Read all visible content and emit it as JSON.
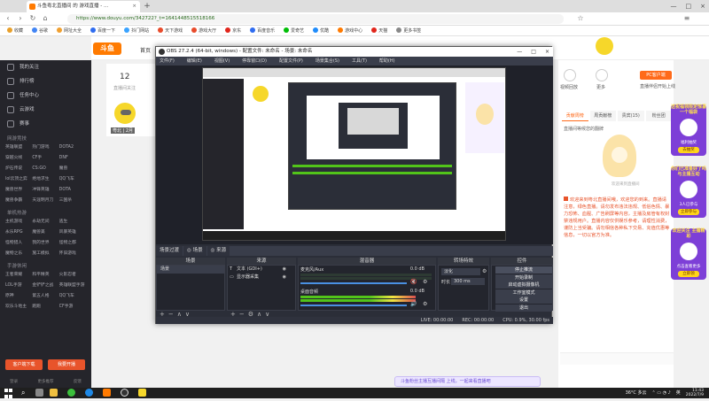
{
  "browser": {
    "tab_title": "斗鱼粤北直播间 的 游戏直播 - ...",
    "tab_close": "×",
    "new_tab": "+",
    "window_controls": [
      "—",
      "□",
      "×"
    ],
    "url": "https://www.douyu.com/342722?_t=1641448515518166",
    "bookmarks": [
      {
        "label": "收藏",
        "color": "#e8a02b"
      },
      {
        "label": "谷歌",
        "color": "#4285f4"
      },
      {
        "label": "网址大全",
        "color": "#f0a030"
      },
      {
        "label": "百度一下",
        "color": "#2f6cf0"
      },
      {
        "label": "抖门网站",
        "color": "#3aa3ff"
      },
      {
        "label": "天下游戏",
        "color": "#e84b2b"
      },
      {
        "label": "游戏大厅",
        "color": "#e84b2b"
      },
      {
        "label": "京东",
        "color": "#e1251b"
      },
      {
        "label": "百度音乐",
        "color": "#2f6cf0"
      },
      {
        "label": "爱奇艺",
        "color": "#00be06"
      },
      {
        "label": "优酷",
        "color": "#1f8cfb"
      },
      {
        "label": "游戏中心",
        "color": "#ff7a00"
      },
      {
        "label": "天猫",
        "color": "#e1251b"
      },
      {
        "label": "更多书签",
        "color": "#888"
      }
    ]
  },
  "douyu": {
    "logo": "斗鱼",
    "nav_home": "首页",
    "card_number": "12",
    "card_text": "直播间关注",
    "streamer_name": "粤北 | 2月",
    "sidebar": {
      "main": [
        "我的关注",
        "排行榜",
        "任务中心",
        "云游戏",
        "赛事"
      ],
      "sections": [
        {
          "title": "网游竞技",
          "items": [
            "英雄联盟",
            "热门游戏",
            "DOTA2",
            "穿越火线",
            "CF手",
            "DNF",
            "炉石传说",
            "CS:GO",
            "魔兽",
            "lol云顶之弈",
            "绝地求生",
            "QQ飞车",
            "魔兽世界",
            "冲锋英雄",
            "DOTA",
            "魔兽争霸",
            "天涯明月刀",
            "三国杀"
          ]
        },
        {
          "title": "单机热游",
          "items": [
            "主机游戏",
            "永劫无间",
            "逃生",
            "永乐RPG",
            "魔兽美",
            "风暴英雄",
            "怪物猎人",
            "我的世界",
            "怪物之都",
            "魔物之乐",
            "施工模拟",
            "怀旧游戏"
          ]
        },
        {
          "title": "手游休闲",
          "items": [
            "王者荣耀",
            "和平精英",
            "火影忍者",
            "LOL手游",
            "金铲铲之战",
            "英雄联盟手游",
            "原神",
            "第五人格",
            "QQ飞车",
            "欢乐斗地主",
            "跑跑",
            "CF手游"
          ]
        }
      ],
      "btn_download": "客户端下载",
      "btn_live": "我要开播",
      "footer": [
        "登录",
        "更多推荐",
        "反馈"
      ]
    },
    "right_panel": {
      "icons": [
        "视频",
        "礼物",
        "贡献"
      ],
      "labels": [
        "视频回放",
        "更多",
        "PC客户端"
      ],
      "pc_button": "PC客户端",
      "pc_sub": "直播伴侣开始上线",
      "tabs": [
        "贡献周榜",
        "周贡献榜",
        "贵宾(15)",
        "粉丝团"
      ],
      "sub": "直播间等候您的翻牌",
      "char_caption": "欢迎来到直播间",
      "text": "欢迎来到粤北直播间哦，欢迎您的到来。直播请注意，绿色直播。请勿发布违法违规、低俗色情、暴力恐怖、血腥、广告刷屏等内容，主播及房管有权封禁违规用户。直播内容仅供娱乐参考，请理性消费，谨防上当受骗。请勿相信各种私下交易、充值优惠等信息，一切以官方为准。"
    },
    "widget_cards": [
      {
        "head": "送祝福领限定惊喜 一个福袋",
        "text": "福利抽奖",
        "btn": "去抽奖"
      },
      {
        "head": "你们已准备好了吗 与主播互动",
        "text": "3人已参与",
        "btn": "立即参与"
      },
      {
        "head": "欢迎关注 主播精彩",
        "text": "点击查看更多",
        "btn": "立即领"
      }
    ],
    "bottom_notice": "斗鱼粉丝主播互播间隔 上线，一起来看直播吧"
  },
  "obs": {
    "title": "OBS 27.2.4 (64-bit, windows) - 配置文件: 未命名 - 场景: 未命名",
    "window_controls": [
      "—",
      "□",
      "×"
    ],
    "menu": [
      "文件(F)",
      "编辑(E)",
      "视图(V)",
      "停靠窗口(D)",
      "配置文件(P)",
      "场景集合(S)",
      "工具(T)",
      "帮助(H)"
    ],
    "dock_tabs": [
      "场景过渡",
      "◎ 场景",
      "◎ 来源"
    ],
    "docks": {
      "scenes": {
        "title": "场景",
        "items": [
          "场景"
        ]
      },
      "sources": {
        "title": "来源",
        "items": [
          {
            "icon": "T",
            "label": "文本 (GDI+)"
          },
          {
            "icon": "▭",
            "label": "显示器采集"
          }
        ]
      },
      "mixer": {
        "title": "混音器",
        "tracks": [
          {
            "name": "麦克风/Aux",
            "db": "0.0 dB"
          },
          {
            "name": "桌面音频",
            "db": "0.0 dB"
          }
        ]
      },
      "transitions": {
        "title": "转场特效",
        "mode": "淡化",
        "duration_label": "时长",
        "duration": "300 ms"
      },
      "controls": {
        "title": "控件",
        "buttons": [
          "停止推流",
          "开始录制",
          "启动虚拟摄像机",
          "工作室模式",
          "设置",
          "退出"
        ]
      }
    },
    "foot_btns": [
      "+",
      "−",
      "∧",
      "∨"
    ],
    "status": [
      "LIVE: 00:00:00",
      "REC: 00:00:00",
      "CPU: 0.9%, 30.00 fps"
    ]
  },
  "taskbar": {
    "search_icon": "⌕",
    "tray_weather": "36°C 多云",
    "tray_lang": "英",
    "time": "11:43",
    "date": "2022/7/9"
  }
}
